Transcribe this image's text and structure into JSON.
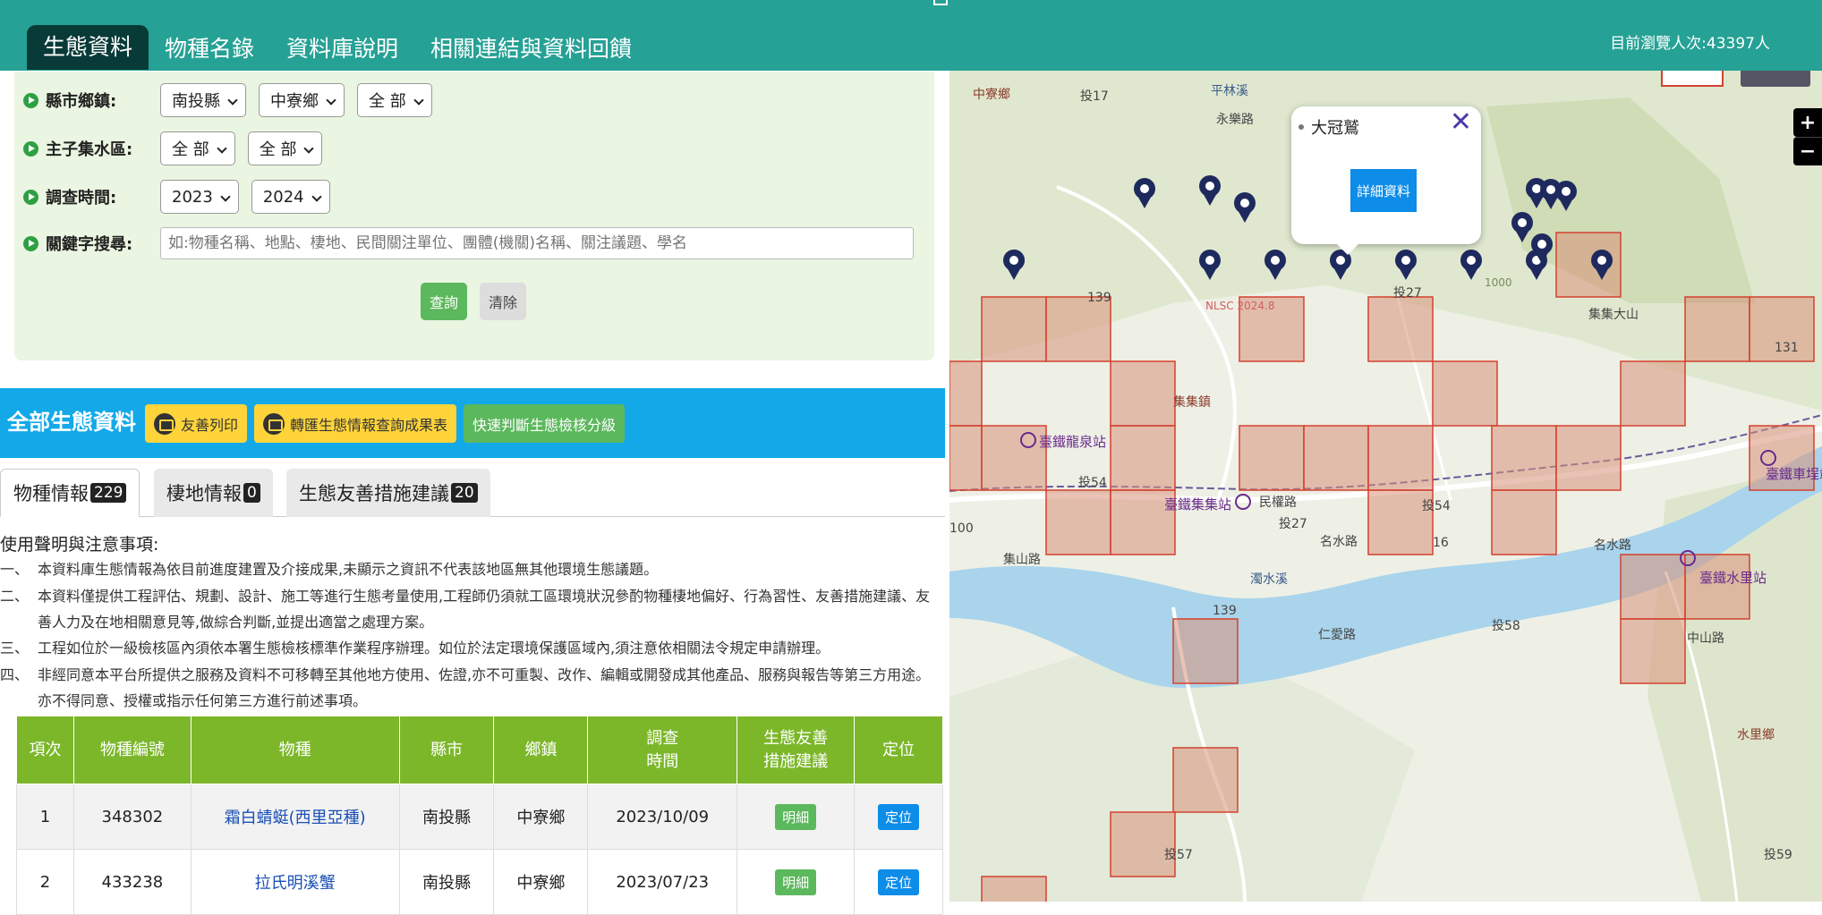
{
  "header": {
    "tabs": [
      {
        "label": "生態資料",
        "active": true
      },
      {
        "label": "物種名錄"
      },
      {
        "label": "資料庫說明"
      },
      {
        "label": "相關連結與資料回饋"
      }
    ],
    "visitor_text": "目前瀏覽人次:43397人"
  },
  "search": {
    "county_label": "縣市鄉鎮:",
    "county_value": "南投縣",
    "township_value": "中寮鄉",
    "village_value": "全 部",
    "basin_label": "主子集水區:",
    "basin_main_value": "全 部",
    "basin_sub_value": "全 部",
    "time_label": "調查時間:",
    "time_from": "2023",
    "time_to": "2024",
    "keyword_label": "關鍵字搜尋:",
    "keyword_placeholder": "如:物種名稱、地點、棲地、民間關注單位、團體(機關)名稱、關注議題、學名",
    "query_btn": "查詢",
    "clear_btn": "清除"
  },
  "banner": {
    "title": "全部生態資料",
    "print_btn": "友善列印",
    "export_btn": "轉匯生態情報查詢成果表",
    "grade_btn": "快速判斷生態檢核分級"
  },
  "tabs": [
    {
      "label": "物種情報",
      "count": "229",
      "active": true
    },
    {
      "label": "棲地情報",
      "count": "0"
    },
    {
      "label": "生態友善措施建議",
      "count": "20"
    }
  ],
  "notices": {
    "title": "使用聲明與注意事項:",
    "items": [
      {
        "num": "一、",
        "text": "本資料庫生態情報為依目前進度建置及介接成果,未顯示之資訊不代表該地區無其他環境生態議題。"
      },
      {
        "num": "二、",
        "text": "本資料僅提供工程評估、規劃、設計、施工等進行生態考量使用,工程師仍須就工區環境狀況參酌物種棲地偏好、行為習性、友善措施建議、友善人力及在地相關意見等,做綜合判斷,並提出適當之處理方案。"
      },
      {
        "num": "三、",
        "text": "工程如位於一級檢核區內須依本署生態檢核標準作業程序辦理。如位於法定環境保護區域內,須注意依相關法令規定申請辦理。"
      },
      {
        "num": "四、",
        "text": "非經同意本平台所提供之服務及資料不可移轉至其他地方使用、佐證,亦不可重製、改作、編輯或開發成其他產品、服務與報告等第三方用途。亦不得同意、授權或指示任何第三方進行前述事項。"
      }
    ]
  },
  "table": {
    "headers": [
      "項次",
      "物種編號",
      "物種",
      "縣市",
      "鄉鎮",
      "調查\n時間",
      "生態友善\n措施建議",
      "定位"
    ],
    "rows": [
      {
        "idx": "1",
        "code": "348302",
        "species": "霜白蜻蜓(西里亞種)",
        "county": "南投縣",
        "town": "中寮鄉",
        "date": "2023/10/09",
        "detail": "明細",
        "locate": "定位"
      },
      {
        "idx": "2",
        "code": "433238",
        "species": "拉氏明溪蟹",
        "county": "南投縣",
        "town": "中寮鄉",
        "date": "2023/07/23",
        "detail": "明細",
        "locate": "定位"
      }
    ]
  },
  "map": {
    "popup": {
      "name": "大冠鷲",
      "button": "詳細資料",
      "close": "✕"
    },
    "zoom_in": "+",
    "zoom_out": "−",
    "labels": {
      "l1": "中寮鄉",
      "l2": "投17",
      "l3": "平林溪",
      "l4": "永樂路",
      "l5": "139",
      "l6": "NLSC 2024.8",
      "l7": "投27",
      "l8": "集集大山",
      "l9": "集集鎮",
      "l10": "臺鐵龍泉站",
      "l11": "投54",
      "l12": "臺鐵集集站",
      "l13": "民權路",
      "l14": "投27",
      "l15": "名水路",
      "l16": "投54",
      "l17": "集山路",
      "l18": "濁水溪",
      "l19": "139",
      "l20": "仁愛路",
      "l21": "投58",
      "l22": "臺鐵水里站",
      "l23": "中山路",
      "l24": "臺鐵車埕站",
      "l25": "131",
      "l26": "水里鄉",
      "l27": "投57",
      "l28": "投59",
      "l29": "1000",
      "l30": "100",
      "l31": "名水路",
      "l32": "16"
    },
    "colors": {
      "grid_fill": "#d9927a",
      "grid_stroke": "#d4412f",
      "river": "#a9d4ec",
      "road": "#ffffff",
      "pin": "#1e2a5e"
    }
  }
}
